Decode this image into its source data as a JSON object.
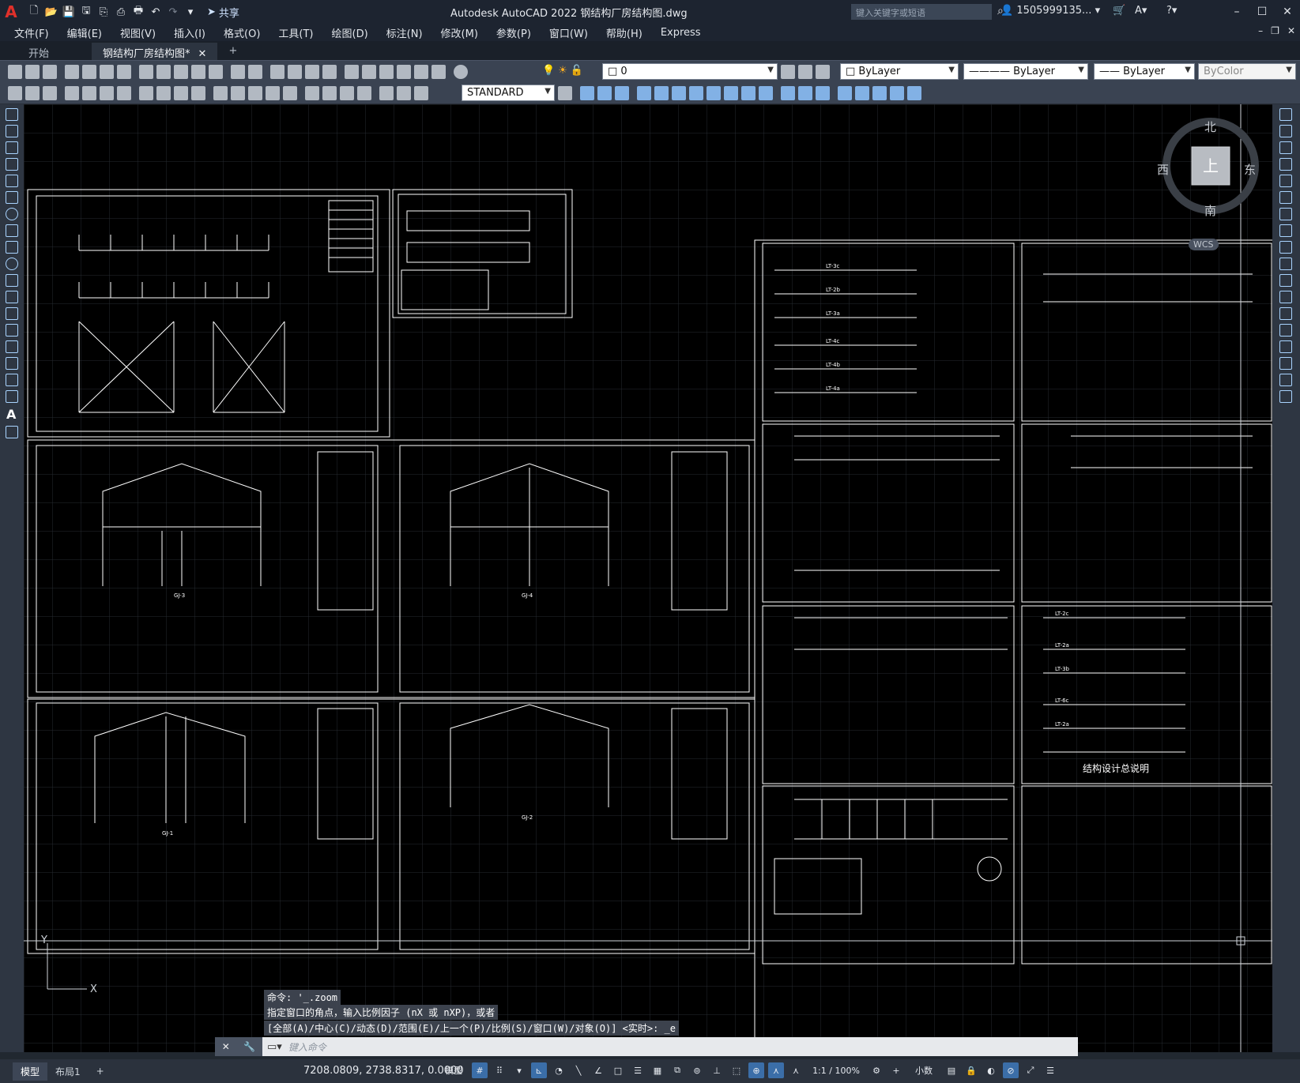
{
  "titlebar": {
    "logo": "A",
    "share_label": "共享",
    "title": "Autodesk AutoCAD 2022    钢结构厂房结构图.dwg",
    "search_placeholder": "键入关键字或短语",
    "user": "1505999135...",
    "icons": [
      "new-icon",
      "open-icon",
      "save-icon",
      "saveas-icon",
      "open-web-icon",
      "save-web-icon",
      "plot-icon",
      "undo-icon",
      "redo-icon",
      "customize-icon"
    ]
  },
  "menu": [
    "文件(F)",
    "编辑(E)",
    "视图(V)",
    "插入(I)",
    "格式(O)",
    "工具(T)",
    "绘图(D)",
    "标注(N)",
    "修改(M)",
    "参数(P)",
    "窗口(W)",
    "帮助(H)",
    "Express"
  ],
  "tabs": [
    {
      "label": "开始",
      "active": false
    },
    {
      "label": "钢结构厂房结构图*",
      "active": true
    }
  ],
  "toolbar1": {
    "layer_value": "0",
    "color_value": "ByLayer",
    "linetype_value": "ByLayer",
    "lineweight_value": "ByLayer",
    "plotstyle_value": "ByColor"
  },
  "toolbar2": {
    "textstyle_value": "STANDARD"
  },
  "viewcube": {
    "north": "北",
    "south": "南",
    "east": "东",
    "west": "西",
    "face": "上",
    "wcs": "WCS"
  },
  "drawing": {
    "sheet_title": "结构设计总说明",
    "labels": [
      "LT-3c",
      "LT-2b",
      "LT-3a",
      "LT-4c",
      "LT-4b",
      "LT-4a",
      "LT-2c",
      "LT-2a",
      "LT-3b",
      "LT-6c",
      "LT-2a"
    ],
    "frame_labels": [
      "GJ-3",
      "GJ-4",
      "GJ-1",
      "GJ-2"
    ]
  },
  "command": {
    "history": [
      "命令: '_.zoom",
      "指定窗口的角点，输入比例因子 (nX 或 nXP)，或者",
      "[全部(A)/中心(C)/动态(D)/范围(E)/上一个(P)/比例(S)/窗口(W)/对象(O)] <实时>: _e"
    ],
    "placeholder": "键入命令"
  },
  "status": {
    "tabs": [
      "模型",
      "布局1"
    ],
    "coords": "7208.0809, 2738.8317, 0.0000",
    "model_label": "模型",
    "scale": "1:1 / 100%",
    "units": "小数"
  },
  "colors": {
    "canvas": "#000000",
    "chrome_dark": "#1d2430",
    "toolbar": "#3a4352",
    "drawing_line": "#ffffff",
    "accent": "#3b6ea8"
  }
}
